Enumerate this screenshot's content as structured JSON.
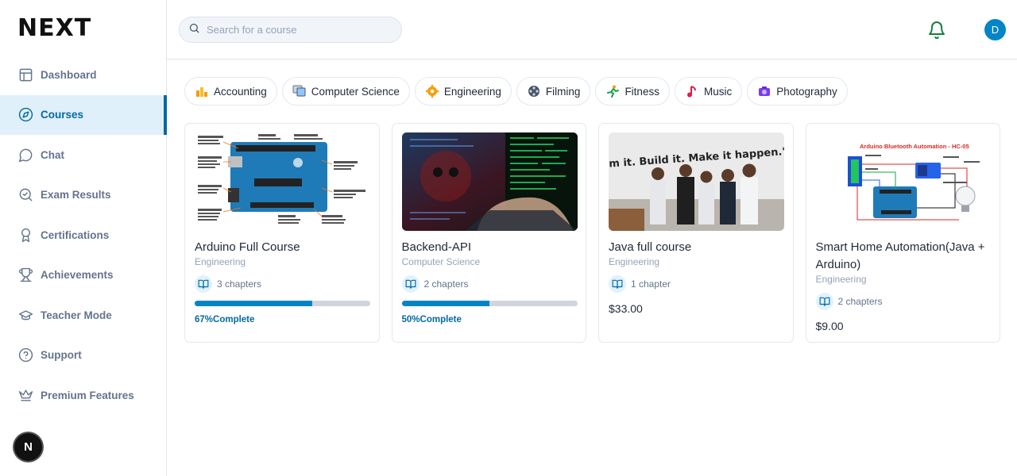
{
  "logo": {
    "text": "NEXT"
  },
  "sidebar": {
    "items": [
      {
        "label": "Dashboard",
        "icon": "layout-icon",
        "active": false
      },
      {
        "label": "Courses",
        "icon": "compass-icon",
        "active": true
      },
      {
        "label": "Chat",
        "icon": "chat-icon",
        "active": false
      },
      {
        "label": "Exam Results",
        "icon": "badge-check-icon",
        "active": false
      },
      {
        "label": "Certifications",
        "icon": "award-icon",
        "active": false
      },
      {
        "label": "Achievements",
        "icon": "trophy-icon",
        "active": false
      },
      {
        "label": "Teacher Mode",
        "icon": "graduation-cap-icon",
        "active": false
      },
      {
        "label": "Support",
        "icon": "help-circle-icon",
        "active": false
      },
      {
        "label": "Premium Features",
        "icon": "crown-icon",
        "active": false
      }
    ],
    "bottom_badge": "N"
  },
  "search": {
    "placeholder": "Search for a course",
    "value": ""
  },
  "user": {
    "initial": "D"
  },
  "categories": [
    {
      "label": "Accounting",
      "icon": "bar-chart-emoji"
    },
    {
      "label": "Computer Science",
      "icon": "computer-emoji"
    },
    {
      "label": "Engineering",
      "icon": "gear-emoji"
    },
    {
      "label": "Filming",
      "icon": "film-reel-emoji"
    },
    {
      "label": "Fitness",
      "icon": "running-emoji"
    },
    {
      "label": "Music",
      "icon": "music-note-emoji"
    },
    {
      "label": "Photography",
      "icon": "camera-emoji"
    }
  ],
  "courses": [
    {
      "title": "Arduino Full Course",
      "category": "Engineering",
      "chapters": "3 chapters",
      "progress": 67,
      "progress_label": "67%Complete",
      "image": "arduino-board-diagram"
    },
    {
      "title": "Backend-API",
      "category": "Computer Science",
      "chapters": "2 chapters",
      "progress": 50,
      "progress_label": "50%Complete",
      "image": "hacker-screen"
    },
    {
      "title": "Java full course",
      "category": "Engineering",
      "chapters": "1 chapter",
      "price": "$33.00",
      "image": "group-photo",
      "banner_text": "m it. Build it. Make it happen.\""
    },
    {
      "title": "Smart Home Automation(Java + Arduino)",
      "category": "Engineering",
      "chapters": "2 chapters",
      "price": "$9.00",
      "image": "arduino-bluetooth-diagram",
      "diagram_title": "Arduino Bluetooth Automation - HC-05"
    }
  ],
  "colors": {
    "accent": "#0369a1",
    "progress": "#0284c7",
    "bell": "#15803d"
  }
}
